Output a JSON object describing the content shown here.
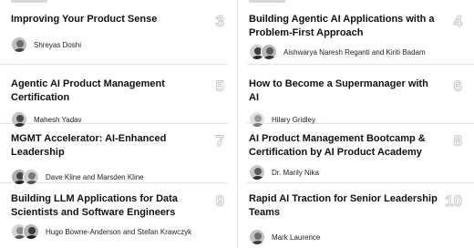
{
  "courses": [
    {
      "title": "Improving Your Product Sense",
      "number": "3",
      "authors": "Shreyas Doshi",
      "avatars": [
        "#6b6b6b"
      ]
    },
    {
      "title": "Building Agentic AI Applications with a Problem-First Approach",
      "number": "4",
      "authors": "Aishwarya Naresh Reganti and Kiriti Badam",
      "avatars": [
        "#3d3d3d",
        "#5a5a5a"
      ]
    },
    {
      "title": "Agentic AI Product Management Certification",
      "number": "5",
      "authors": "Mahesh Yadav",
      "avatars": [
        "#4a4a4a"
      ]
    },
    {
      "title": "How to Become a Supermanager with AI",
      "number": "6",
      "authors": "Hilary Gridley",
      "avatars": [
        "#9a9a9a"
      ]
    },
    {
      "title": "MGMT Accelerator: AI-Enhanced Leadership",
      "number": "7",
      "authors": "Dave Kline and Marsden Kline",
      "avatars": [
        "#444444",
        "#7a7a7a"
      ]
    },
    {
      "title": "AI Product Management Bootcamp & Certification by AI Product Academy",
      "number": "8",
      "authors": "Dr. Marily Nika",
      "avatars": [
        "#5c5c5c"
      ]
    },
    {
      "title": "Building LLM Applications for Data Scientists and Software Engineers",
      "number": "9",
      "authors": "Hugo Bowne-Anderson and Stefan Krawczyk",
      "avatars": [
        "#8a8a8a",
        "#3a3a3a"
      ]
    },
    {
      "title": "Rapid AI Traction for Senior Leadership Teams",
      "number": "10",
      "authors": "Mark Laurence",
      "avatars": [
        "#6e6e6e"
      ]
    }
  ]
}
